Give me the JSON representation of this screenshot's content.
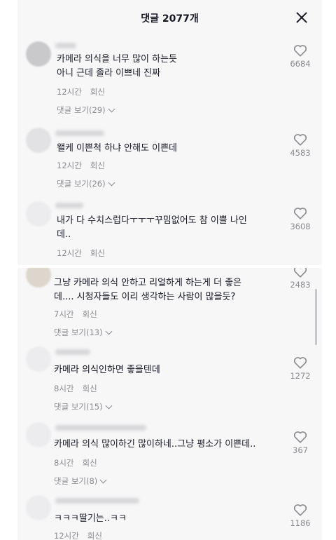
{
  "header": {
    "title": "댓글 2077개"
  },
  "replies_suffix": "보기",
  "comments_top": [
    {
      "text": "카메라 의식을 너무 많이 하는듯\n아니 근데 졸라 이쁘네 진짜",
      "time": "12시간",
      "reply": "회신",
      "view_replies": "댓글 보기(29)",
      "likes": "6684"
    },
    {
      "text": "왤케 이쁜척 하냐 안해도 이쁜데",
      "time": "12시간",
      "reply": "회신",
      "view_replies": "댓글 보기(26)",
      "likes": "4583"
    },
    {
      "text": "내가 다 수치스럽다ㅜㅜㅜ꾸밈없어도 참 이쁠 나인\n데..",
      "time": "12시간",
      "reply": "회신",
      "likes": "3608"
    }
  ],
  "comments_bottom": [
    {
      "text": "그냥 카메라 의식 안하고 리얼하게 하는게 더 좋은\n데.... 시청자들도 이리 생각하는 사람이 많을듯?",
      "time": "7시간",
      "reply": "회신",
      "view_replies": "댓글 보기(13)",
      "likes": "2483"
    },
    {
      "text": "카메라 의식인하면 좋을텐데",
      "time": "8시간",
      "reply": "회신",
      "view_replies": "댓글 보기(15)",
      "likes": "1272"
    },
    {
      "text": "카메라 의식 많이하긴 많이하네..그냥 평소가 이쁜데..",
      "time": "8시간",
      "reply": "회신",
      "view_replies": "댓글 보기(8)",
      "likes": "367"
    },
    {
      "text": "ㅋㅋㅋ딸기는..ㅋㅋ",
      "time": "12시간",
      "reply": "회신",
      "likes": "1186"
    }
  ],
  "icons": {
    "like": "heart-outline-icon",
    "close": "close-icon",
    "expand": "chevron-down-icon"
  },
  "colors": {
    "text": "#161823",
    "muted": "#8a8b91",
    "background": "#f7f7f8"
  }
}
